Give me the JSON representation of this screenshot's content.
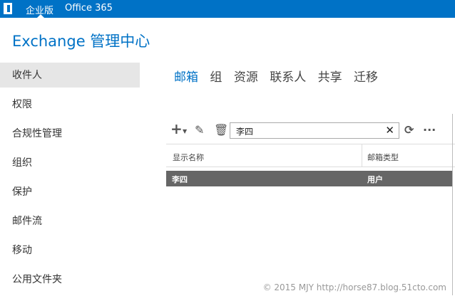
{
  "topbar": {
    "edition": "企业版",
    "product": "Office 365"
  },
  "title": "Exchange 管理中心",
  "sidebar": {
    "items": [
      {
        "label": "收件人"
      },
      {
        "label": "权限"
      },
      {
        "label": "合规性管理"
      },
      {
        "label": "组织"
      },
      {
        "label": "保护"
      },
      {
        "label": "邮件流"
      },
      {
        "label": "移动"
      },
      {
        "label": "公用文件夹"
      }
    ]
  },
  "tabs": [
    {
      "label": "邮箱"
    },
    {
      "label": "组"
    },
    {
      "label": "资源"
    },
    {
      "label": "联系人"
    },
    {
      "label": "共享"
    },
    {
      "label": "迁移"
    }
  ],
  "search": {
    "value": "李四"
  },
  "table": {
    "headers": [
      "显示名称",
      "邮箱类型"
    ],
    "rows": [
      [
        "李四",
        "用户"
      ]
    ]
  },
  "watermark": "© 2015 MJY http://horse87.blog.51cto.com"
}
